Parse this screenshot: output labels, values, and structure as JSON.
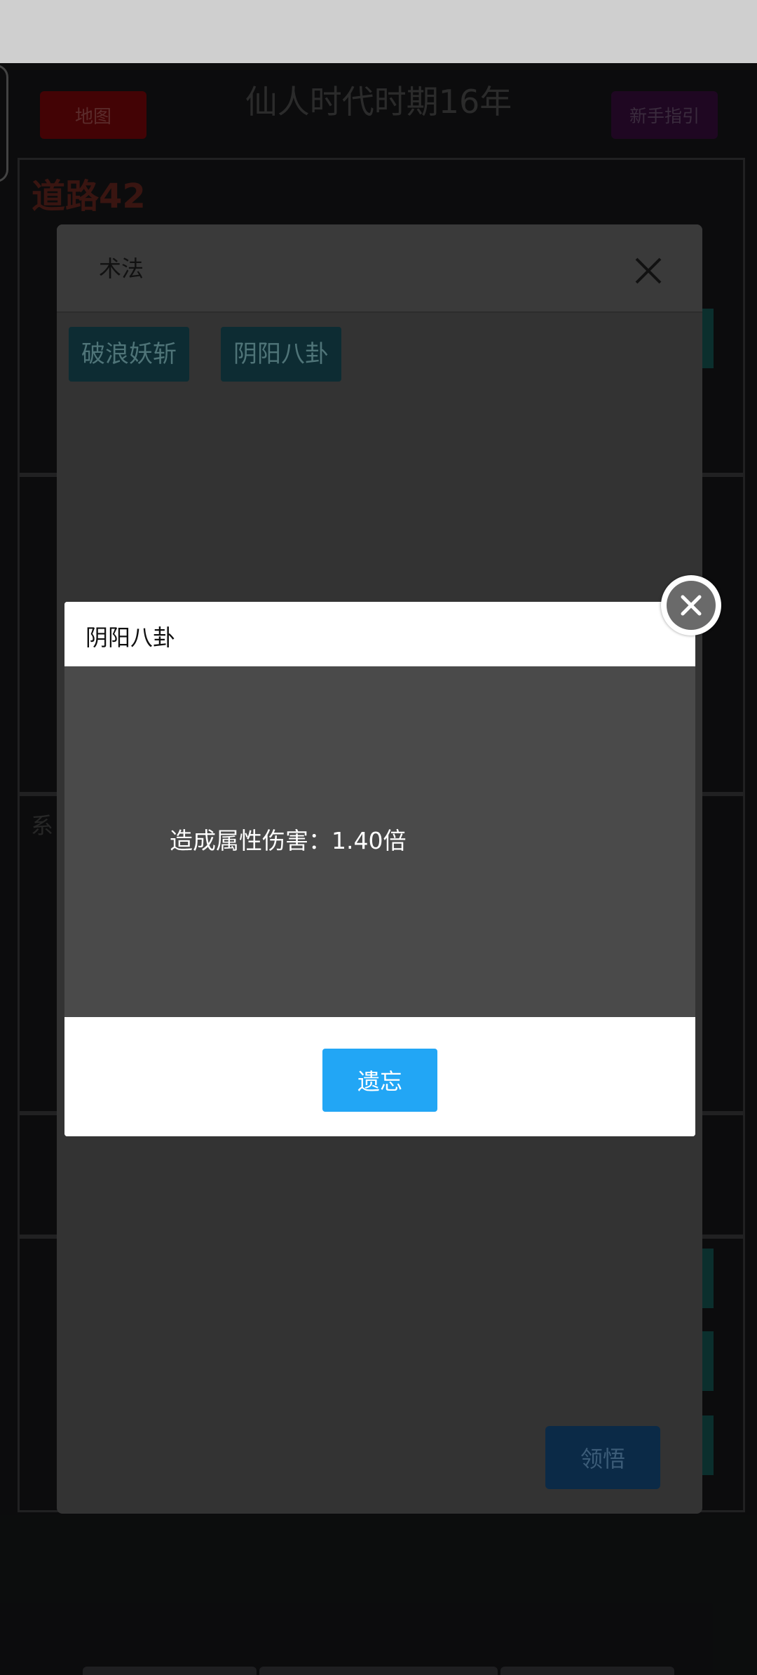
{
  "header": {
    "map_label": "地图",
    "era_title": "仙人时代时期16年",
    "guide_label": "新手指引"
  },
  "background": {
    "road_title": "道路42",
    "panel_label": "系"
  },
  "skill_modal": {
    "title": "术法",
    "tags": [
      "破浪妖斩",
      "阴阳八卦"
    ],
    "comprehend_label": "领悟"
  },
  "detail_dialog": {
    "title": "阴阳八卦",
    "description": "造成属性伤害：1.40倍",
    "forget_label": "遗忘"
  },
  "colors": {
    "primary_button": "#22a6f5",
    "map_button": "#5a0507",
    "guide_button": "#2a0a2e",
    "tag_background": "#0d2c33"
  },
  "icons": {
    "skill_close": "close-icon",
    "dialog_close": "close-circle-icon"
  }
}
